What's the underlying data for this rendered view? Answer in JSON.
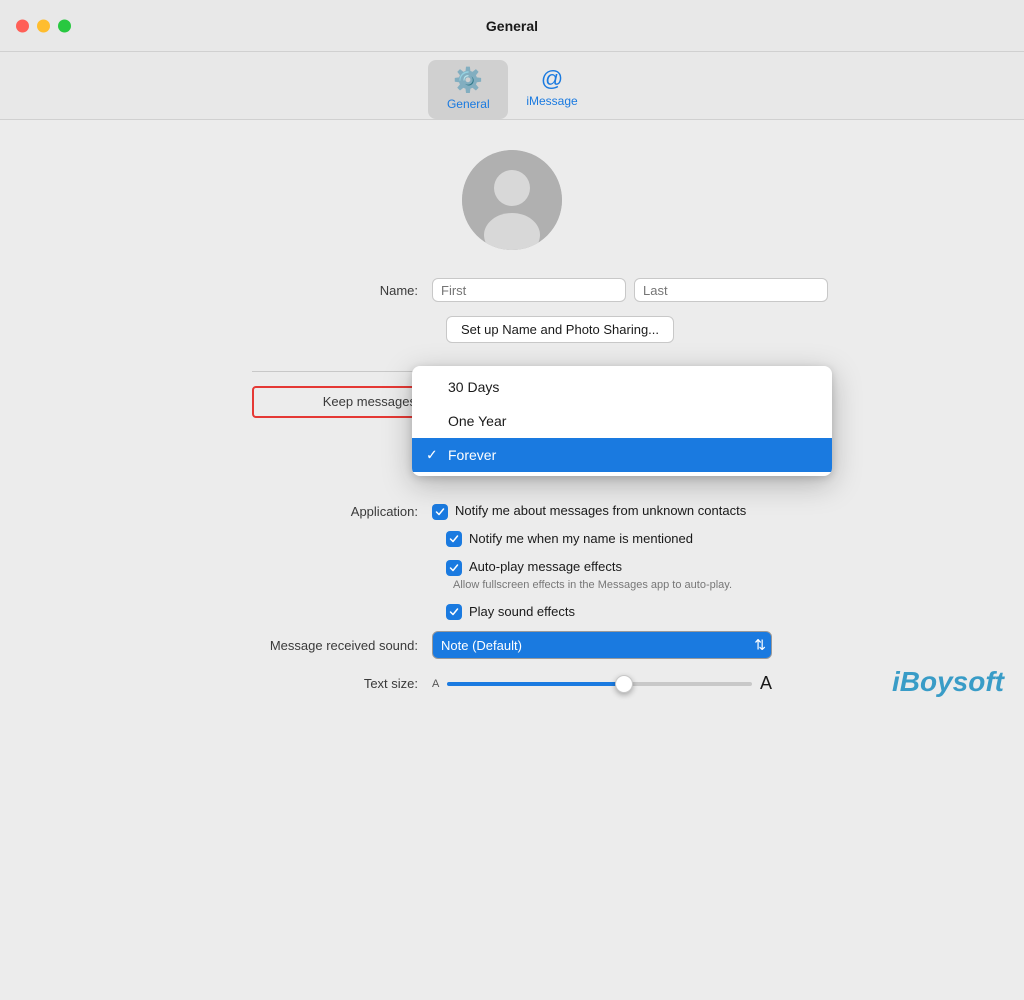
{
  "titlebar": {
    "title": "General"
  },
  "tabs": [
    {
      "id": "general",
      "label": "General",
      "icon": "⚙️",
      "active": true
    },
    {
      "id": "imessage",
      "label": "iMessage",
      "icon": "@",
      "active": false
    }
  ],
  "name_field": {
    "first_placeholder": "First",
    "last_placeholder": "Last"
  },
  "setup_btn": {
    "label": "Set up Name and Photo Sharing..."
  },
  "keep_messages": {
    "label": "Keep messages",
    "options": [
      {
        "value": "30days",
        "text": "30 Days",
        "selected": false
      },
      {
        "value": "oneyear",
        "text": "One Year",
        "selected": false
      },
      {
        "value": "forever",
        "text": "Forever",
        "selected": true
      }
    ]
  },
  "application_label": "Application:",
  "checkboxes": [
    {
      "id": "unknown-contacts",
      "checked": true,
      "label": "Notify me about messages from unknown contacts",
      "sublabel": ""
    },
    {
      "id": "name-mentioned",
      "checked": true,
      "label": "Notify me when my name is mentioned",
      "sublabel": ""
    },
    {
      "id": "autoplay-effects",
      "checked": true,
      "label": "Auto-play message effects",
      "sublabel": "Allow fullscreen effects in the Messages app to auto-play."
    },
    {
      "id": "play-sound",
      "checked": true,
      "label": "Play sound effects",
      "sublabel": ""
    }
  ],
  "message_received_sound": {
    "label": "Message received sound:",
    "value": "Note (Default)"
  },
  "text_size": {
    "label": "Text size:",
    "small_a": "A",
    "large_a": "A",
    "value": 60
  },
  "watermark": "iBoysoft"
}
